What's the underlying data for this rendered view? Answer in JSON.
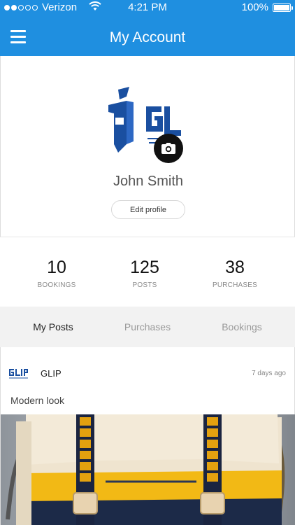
{
  "status_bar": {
    "carrier": "Verizon",
    "time": "4:21 PM",
    "battery": "100%",
    "battery_level": 1.0,
    "signal_filled": 2,
    "signal_total": 5
  },
  "header": {
    "title": "My Account",
    "color": "#1f8fe0"
  },
  "profile": {
    "name": "John Smith",
    "edit_label": "Edit profile"
  },
  "stats": [
    {
      "value": "10",
      "label": "BOOKINGS"
    },
    {
      "value": "125",
      "label": "POSTS"
    },
    {
      "value": "38",
      "label": "PURCHASES"
    }
  ],
  "tabs": [
    {
      "label": "My Posts",
      "active": true
    },
    {
      "label": "Purchases",
      "active": false
    },
    {
      "label": "Bookings",
      "active": false
    }
  ],
  "post": {
    "author": "GLIP",
    "time": "7 days ago",
    "caption": "Modern look"
  }
}
